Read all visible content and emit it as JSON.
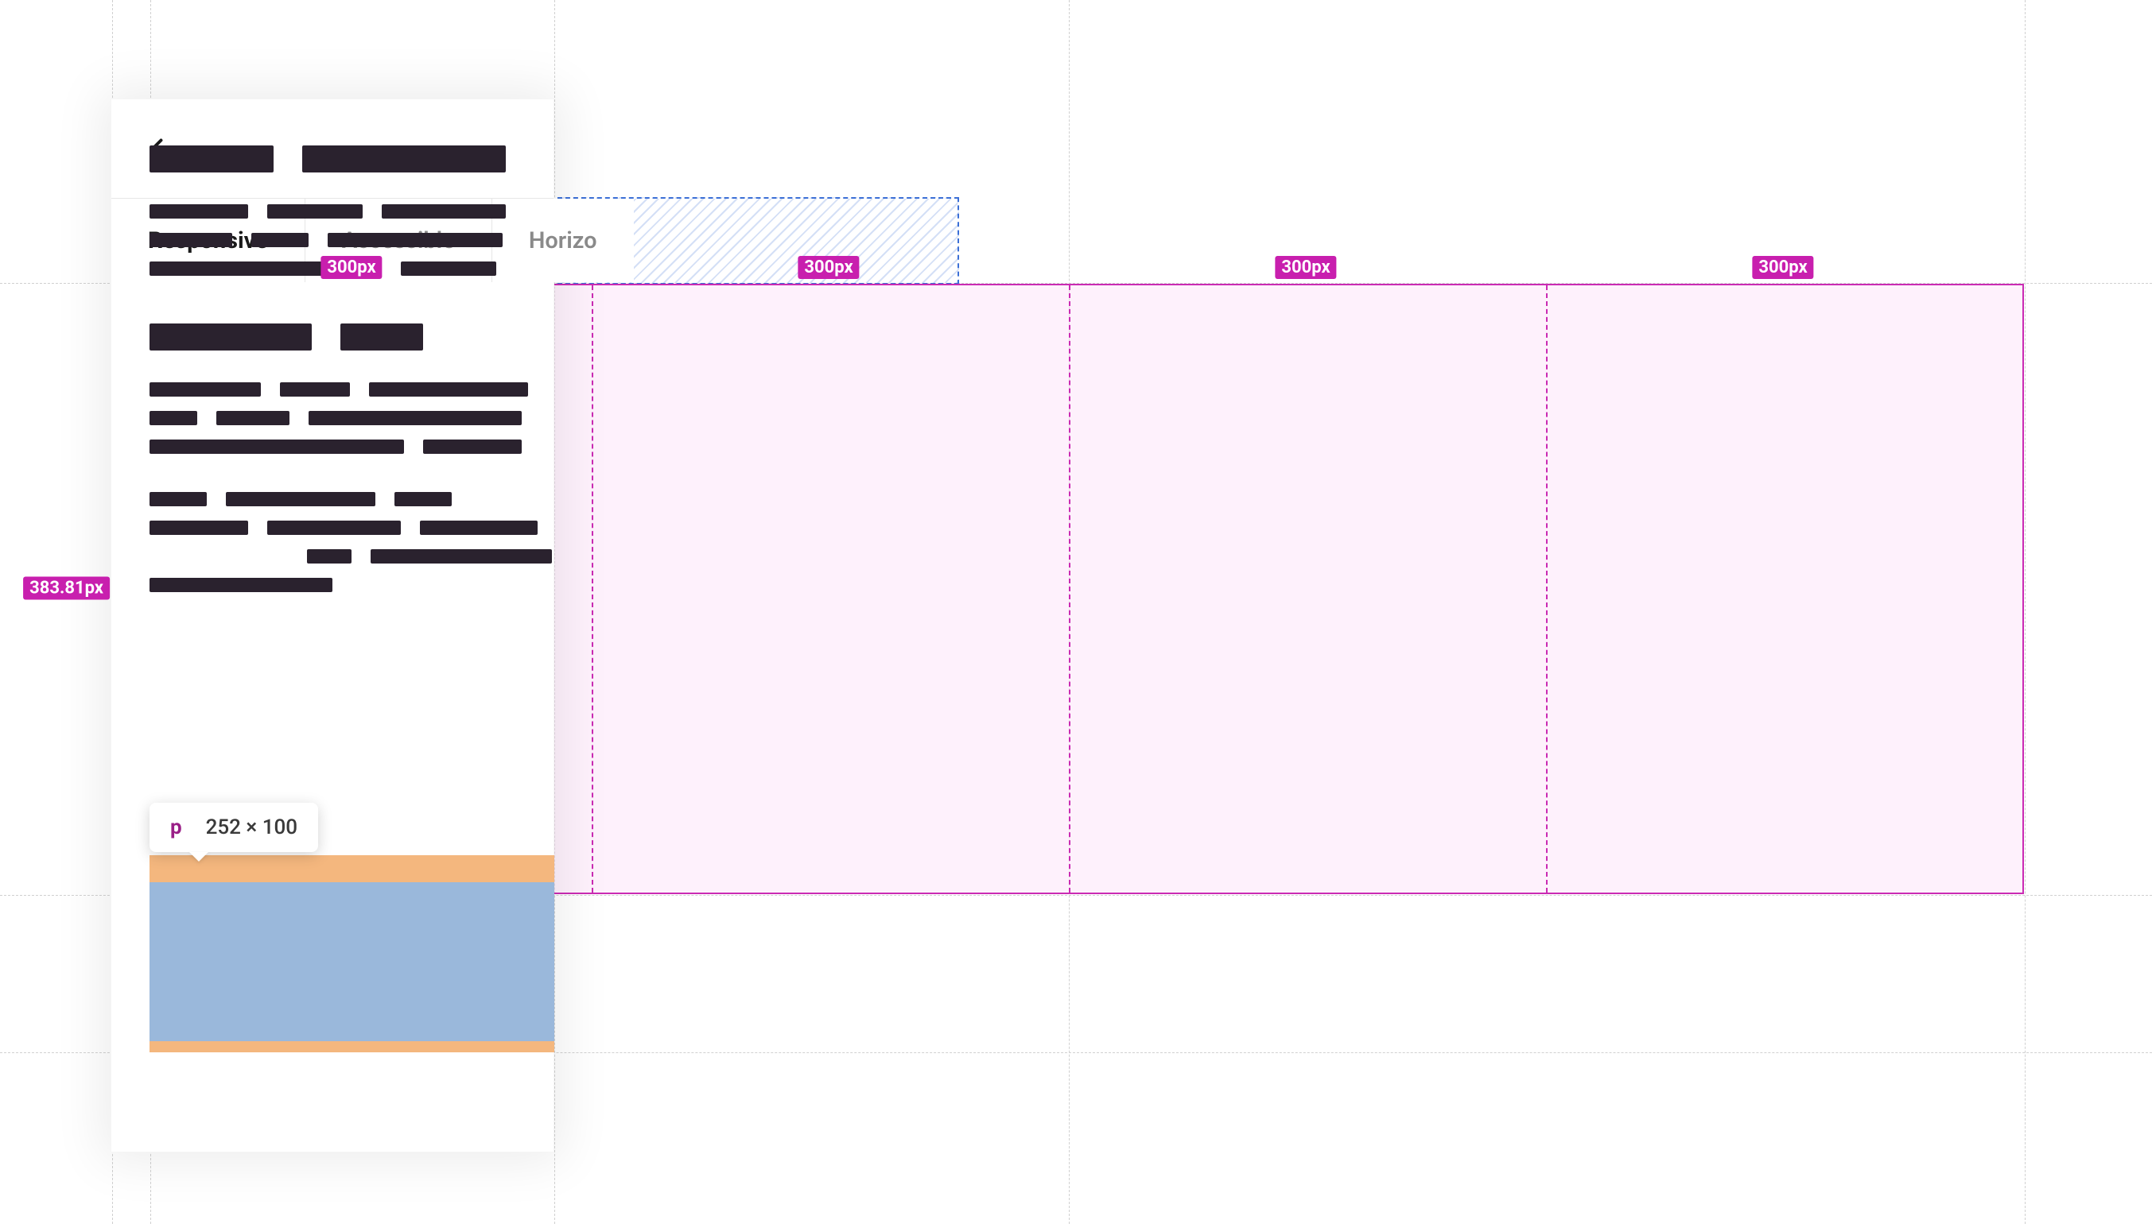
{
  "tabs": {
    "items": [
      {
        "label": "Responsive",
        "active": true
      },
      {
        "label": "Accessible",
        "active": false
      },
      {
        "label": "Horizo",
        "active": false
      }
    ]
  },
  "grid": {
    "height_label": "383.81px",
    "col_labels": [
      "300px",
      "300px",
      "300px",
      "300px"
    ]
  },
  "tooltip": {
    "tag": "p",
    "dimensions": "252 × 100"
  }
}
